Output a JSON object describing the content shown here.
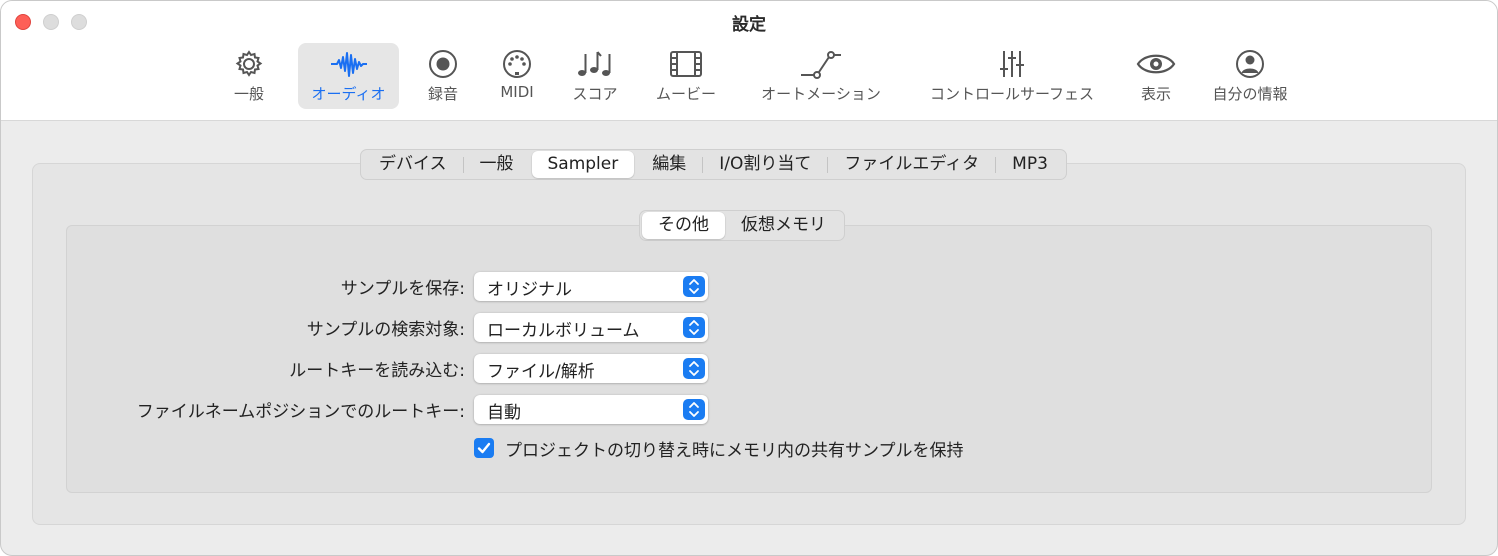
{
  "window": {
    "title": "設定"
  },
  "toolbar": {
    "items": [
      {
        "label": "一般",
        "icon": "gear-icon"
      },
      {
        "label": "オーディオ",
        "icon": "waveform-icon",
        "active": true
      },
      {
        "label": "録音",
        "icon": "record-icon"
      },
      {
        "label": "MIDI",
        "icon": "midi-connector-icon"
      },
      {
        "label": "スコア",
        "icon": "music-notes-icon"
      },
      {
        "label": "ムービー",
        "icon": "film-icon"
      },
      {
        "label": "オートメーション",
        "icon": "automation-curve-icon"
      },
      {
        "label": "コントロールサーフェス",
        "icon": "sliders-icon"
      },
      {
        "label": "表示",
        "icon": "eye-icon"
      },
      {
        "label": "自分の情報",
        "icon": "person-icon"
      }
    ],
    "accent_color": "#1a6ff2"
  },
  "tabs": {
    "items": [
      "デバイス",
      "一般",
      "Sampler",
      "編集",
      "I/O割り当て",
      "ファイルエディタ",
      "MP3"
    ],
    "selected": "Sampler"
  },
  "subtabs": {
    "items": [
      "その他",
      "仮想メモリ"
    ],
    "selected": "その他"
  },
  "settings": {
    "rows": [
      {
        "label": "サンプルを保存:",
        "value": "オリジナル"
      },
      {
        "label": "サンプルの検索対象:",
        "value": "ローカルボリューム"
      },
      {
        "label": "ルートキーを読み込む:",
        "value": "ファイル/解析"
      },
      {
        "label": "ファイルネームポジションでのルートキー:",
        "value": "自動"
      }
    ],
    "checkbox": {
      "label": "プロジェクトの切り替え時にメモリ内の共有サンプルを保持",
      "checked": true
    }
  }
}
